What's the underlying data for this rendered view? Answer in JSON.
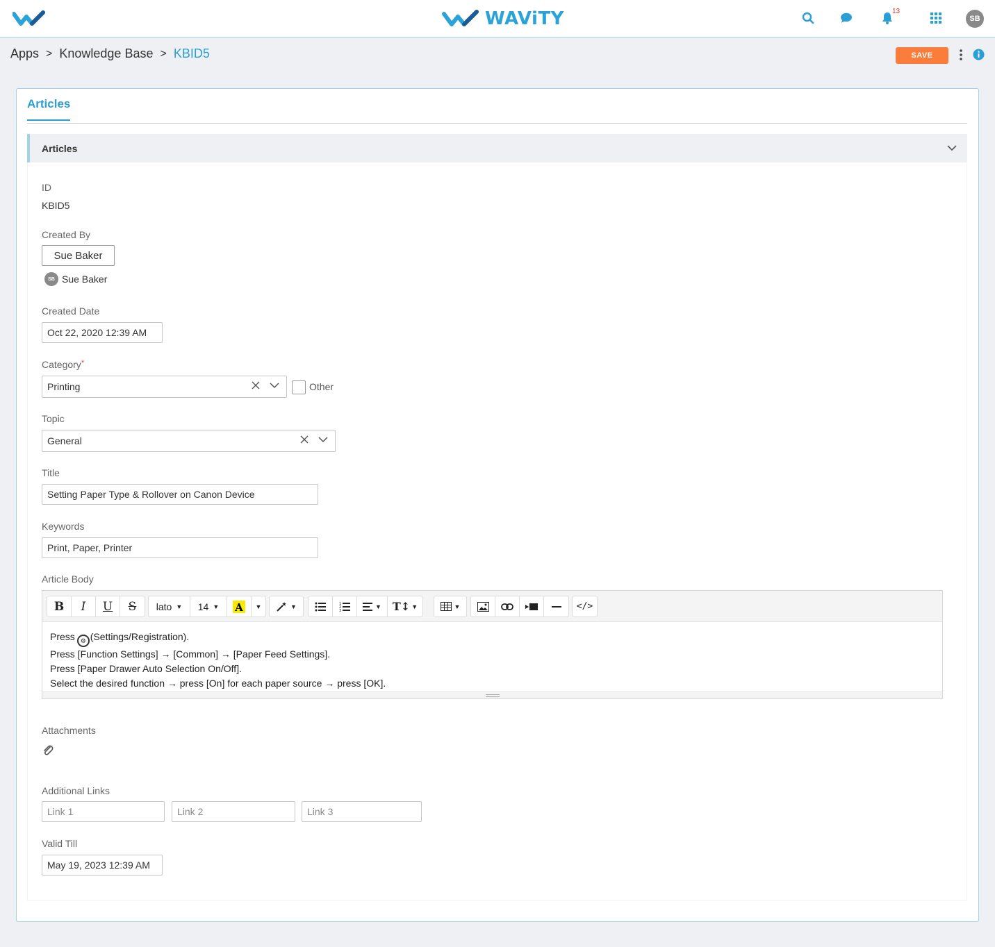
{
  "brand": {
    "name": "WAViTY",
    "color": "#2aa3d8"
  },
  "topbar": {
    "notification_count": "13",
    "avatar_initials": "SB",
    "icons": [
      "search-icon",
      "chat-icon",
      "bell-icon",
      "apps-grid-icon"
    ]
  },
  "breadcrumb": {
    "items": [
      "Apps",
      "Knowledge Base"
    ],
    "separator": ">",
    "current": "KBID5"
  },
  "actions": {
    "save_label": "SAVE",
    "save_color": "#fb7c3b"
  },
  "tabs": {
    "active": "Articles"
  },
  "section": {
    "title": "Articles"
  },
  "form": {
    "id": {
      "label": "ID",
      "value": "KBID5"
    },
    "created_by": {
      "label": "Created By",
      "chip": "Sue Baker",
      "avatar_initials": "SB",
      "user_name": "Sue Baker"
    },
    "created_date": {
      "label": "Created Date",
      "value": "Oct 22, 2020 12:39 AM"
    },
    "category": {
      "label": "Category",
      "required_mark": "*",
      "value": "Printing",
      "other_label": "Other"
    },
    "topic": {
      "label": "Topic",
      "value": "General"
    },
    "title": {
      "label": "Title",
      "value": "Setting Paper Type & Rollover on Canon Device"
    },
    "keywords": {
      "label": "Keywords",
      "value": "Print, Paper, Printer"
    },
    "article_body": {
      "label": "Article Body",
      "font_name": "lato",
      "font_size": "14",
      "lines": [
        "Press",
        "(Settings/Registration).",
        "Press [Function Settings] → [Common] → [Paper Feed Settings].",
        "Press [Paper Drawer Auto Selection On/Off].",
        "Select the desired function → press [On] for each paper source → press [OK]."
      ]
    },
    "attachments": {
      "label": "Attachments"
    },
    "additional_links": {
      "label": "Additional Links",
      "placeholders": [
        "Link 1",
        "Link 2",
        "Link 3"
      ]
    },
    "valid_till": {
      "label": "Valid Till",
      "value": "May 19, 2023 12:39 AM"
    }
  }
}
